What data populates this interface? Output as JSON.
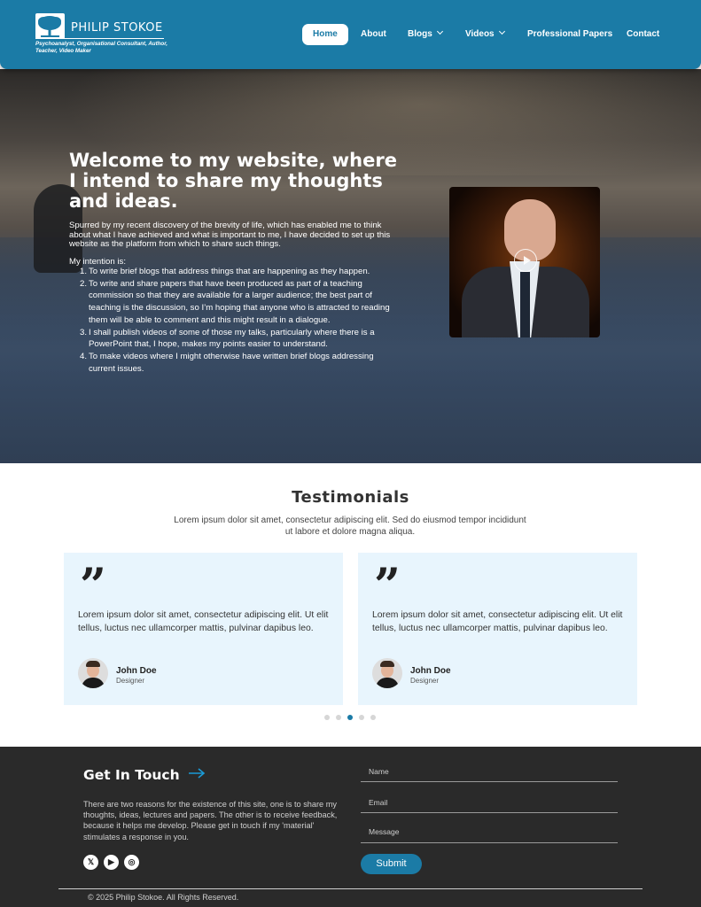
{
  "brand": {
    "name": "PHILIP STOKOE",
    "tagline": "Psychoanalyst, Organisational Consultant, Author, Teacher, Video Maker",
    "logo_icon": "tree-icon"
  },
  "nav": {
    "items": [
      {
        "label": "Home",
        "active": true
      },
      {
        "label": "About"
      },
      {
        "label": "Blogs",
        "dropdown": true
      },
      {
        "label": "Videos",
        "dropdown": true
      },
      {
        "label": "Professional Papers"
      },
      {
        "label": "Contact"
      }
    ]
  },
  "hero": {
    "title": "Welcome to my website, where I intend to share my thoughts and ideas.",
    "intro": "Spurred by my recent discovery of the brevity of life, which has enabled me to think about what I have achieved and what is important to me, I have decided to set up this website as the platform from which to share such things.",
    "intention_label": "My intention is:",
    "intentions": [
      "To write brief blogs that address things that are happening as they happen.",
      "To write and share papers that have been produced as part of a teaching commission so that they are available for a larger audience; the best part of teaching is the discussion, so I’m hoping that anyone who is attracted to reading them will be able to comment and this might result in a dialogue.",
      "I shall publish videos of some of those my talks, particularly where there is a PowerPoint that, I hope, makes my points easier to understand.",
      "To make videos where I might otherwise have written brief blogs addressing current issues."
    ],
    "video_icon": "play-icon"
  },
  "testimonials": {
    "title": "Testimonials",
    "subtitle": "Lorem ipsum dolor sit amet, consectetur adipiscing elit. Sed do eiusmod tempor incididunt ut labore et dolore magna aliqua.",
    "cards": [
      {
        "quote": "Lorem ipsum dolor sit amet, consectetur adipiscing elit. Ut elit tellus, luctus nec ullamcorper mattis, pulvinar dapibus leo.",
        "name": "John Doe",
        "role": "Designer"
      },
      {
        "quote": "Lorem ipsum dolor sit amet, consectetur adipiscing elit. Ut elit tellus, luctus nec ullamcorper mattis, pulvinar dapibus leo.",
        "name": "John Doe",
        "role": "Designer"
      }
    ],
    "dots": 5,
    "active_dot": 3
  },
  "footer": {
    "title": "Get In Touch",
    "text": "There are two reasons for the existence of this site, one is to share my thoughts, ideas, lectures and papers. The other is to receive feedback, because it helps me develop. Please get in touch if my 'material' stimulates a response in you.",
    "social": [
      {
        "icon": "x-icon",
        "glyph": "𝕏"
      },
      {
        "icon": "youtube-icon",
        "glyph": "▶"
      },
      {
        "icon": "instagram-icon",
        "glyph": "◎"
      }
    ],
    "form": {
      "name_placeholder": "Name",
      "email_placeholder": "Email",
      "message_placeholder": "Message",
      "submit_label": "Submit"
    },
    "copyright": "© 2025 Philip Stokoe. All Rights Reserved."
  },
  "colors": {
    "brand_blue": "#1b7ba6",
    "card_bg": "#e8f5fd",
    "footer_bg": "#2a2a2a"
  }
}
